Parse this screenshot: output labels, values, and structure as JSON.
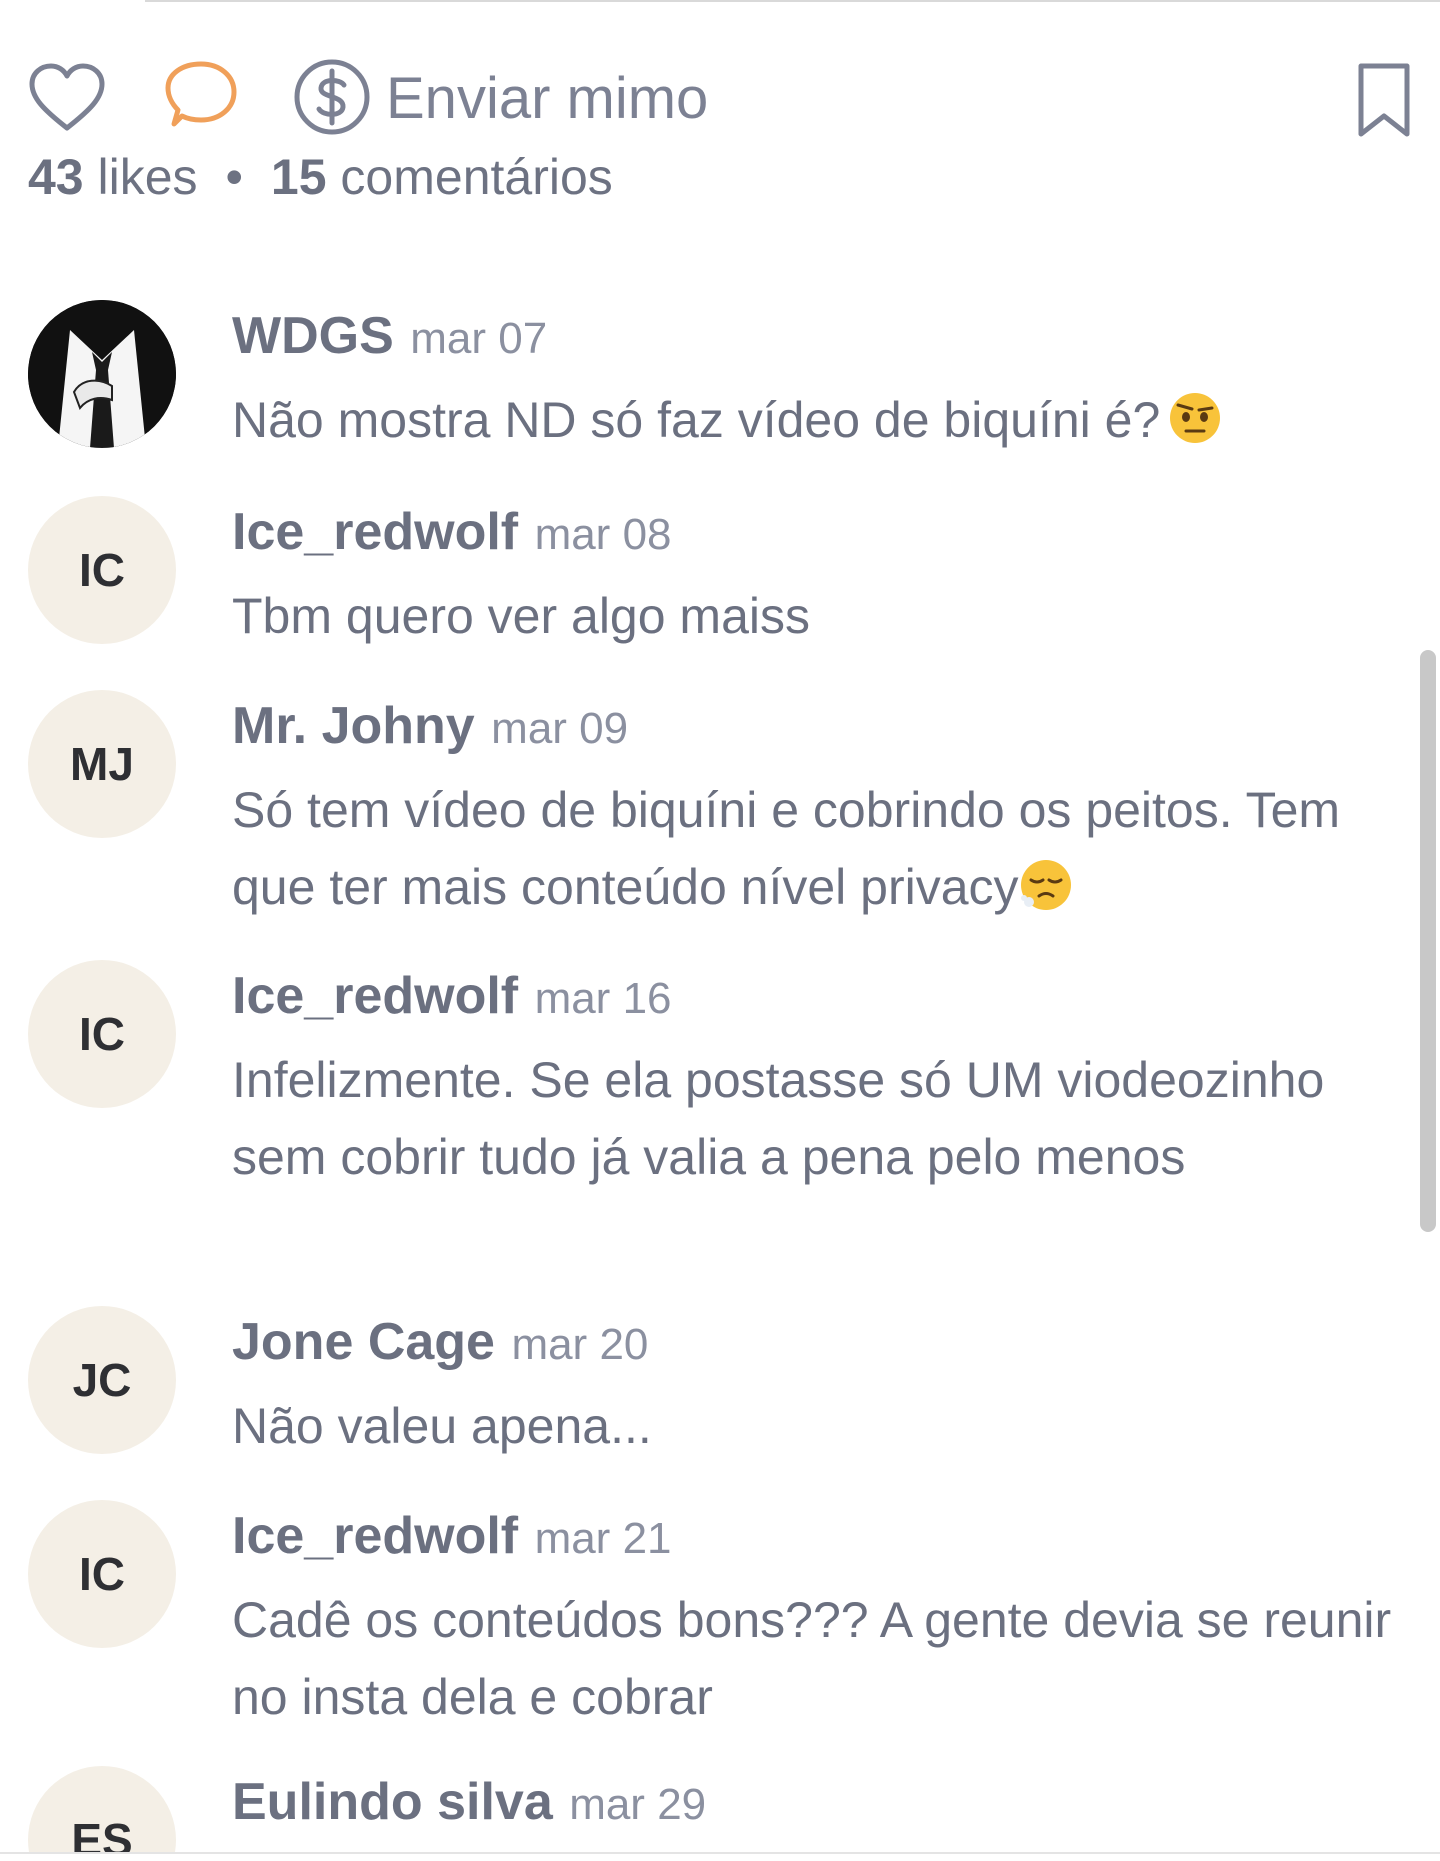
{
  "actions": {
    "tip_label": "Enviar mimo",
    "like_icon": "heart-icon",
    "comment_icon": "comment-bubble-icon",
    "tip_icon": "dollar-circle-icon",
    "save_icon": "bookmark-icon",
    "comment_icon_color": "#f0a05a"
  },
  "stats": {
    "likes_count": "43",
    "likes_label": "likes",
    "separator": "•",
    "comments_count": "15",
    "comments_label": "comentários"
  },
  "comments": [
    {
      "author": "WDGS",
      "date": "mar 07",
      "text": "Não mostra ND só faz vídeo de biquíni é?",
      "emoji": "raised-eyebrow-face",
      "avatar": "photo"
    },
    {
      "author": "Ice_redwolf",
      "date": "mar 08",
      "text": "Tbm quero ver algo maiss",
      "initials": "IC"
    },
    {
      "author": "Mr. Johny",
      "date": "mar 09",
      "text": "Só tem vídeo de biquíni e cobrindo os peitos. Tem que ter mais conteúdo nível privacy",
      "emoji": "face-exhaling",
      "initials": "MJ"
    },
    {
      "author": "Ice_redwolf",
      "date": "mar 16",
      "text": "Infelizmente. Se ela postasse só UM viodeozinho sem cobrir tudo já valia a pena pelo menos",
      "initials": "IC"
    },
    {
      "author": "Jone Cage",
      "date": "mar 20",
      "text": "Não valeu apena...",
      "initials": "JC"
    },
    {
      "author": "Ice_redwolf",
      "date": "mar 21",
      "text": "Cadê os conteúdos bons??? A gente devia se reunir no insta dela e cobrar",
      "initials": "IC"
    },
    {
      "author": "Eulindo silva",
      "date": "mar 29",
      "text": "",
      "initials": "ES"
    }
  ]
}
